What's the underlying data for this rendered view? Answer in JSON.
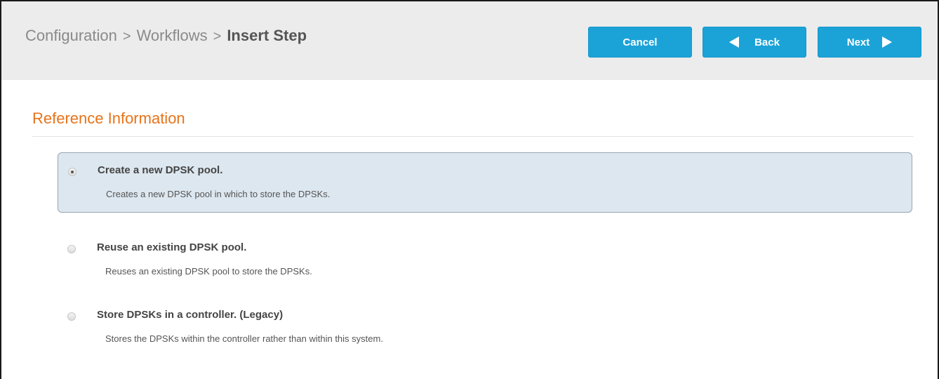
{
  "breadcrumb": {
    "items": [
      "Configuration",
      "Workflows"
    ],
    "separator": ">",
    "current": "Insert Step"
  },
  "toolbar": {
    "cancel_label": "Cancel",
    "back_label": "Back",
    "next_label": "Next"
  },
  "section": {
    "title": "Reference Information"
  },
  "options": [
    {
      "label": "Create a new DPSK pool.",
      "description": "Creates a new DPSK pool in which to store the DPSKs.",
      "selected": true
    },
    {
      "label": "Reuse an existing DPSK pool.",
      "description": "Reuses an existing DPSK pool to store the DPSKs.",
      "selected": false
    },
    {
      "label": "Store DPSKs in a controller. (Legacy)",
      "description": "Stores the DPSKs within the controller rather than within this system.",
      "selected": false
    }
  ],
  "colors": {
    "accent": "#1ba3d8",
    "section_title": "#e8731a",
    "selected_bg": "#dde7ef"
  },
  "icons": {
    "back": "triangle-left-icon",
    "next": "triangle-right-icon"
  }
}
